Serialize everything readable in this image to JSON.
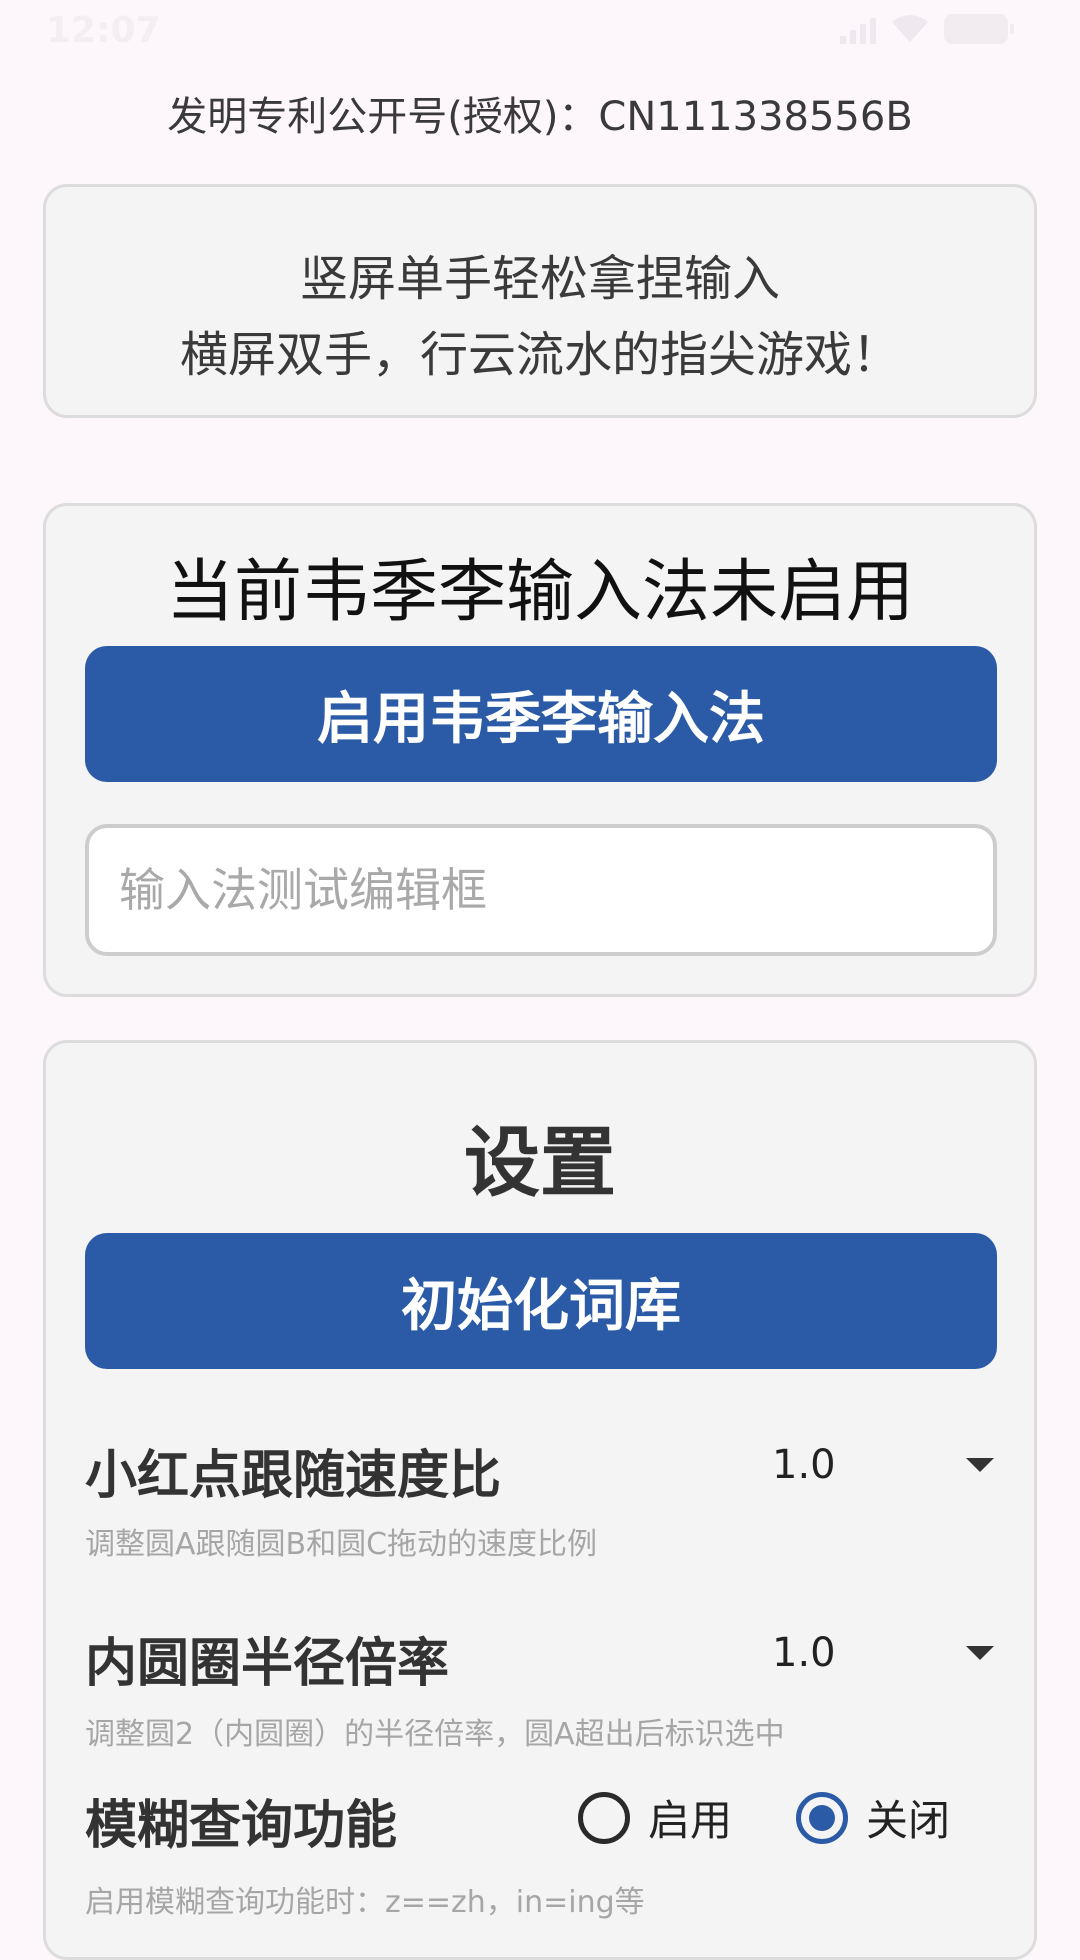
{
  "status_bar": {
    "time": "12:07",
    "icons": [
      "signal-icon",
      "wifi-icon",
      "battery-icon"
    ]
  },
  "patent": {
    "text": "发明专利公开号(授权)：CN111338556B"
  },
  "slogan": {
    "line1": "竖屏单手轻松拿捏输入",
    "line2": "横屏双手，行云流水的指尖游戏！"
  },
  "ime_status": {
    "title": "当前韦季李输入法未启用",
    "enable_button": "启用韦季李输入法",
    "test_input_placeholder": "输入法测试编辑框",
    "test_input_value": ""
  },
  "settings": {
    "title": "设置",
    "init_button": "初始化词库",
    "follow_speed": {
      "label": "小红点跟随速度比",
      "value": "1.0",
      "description": "调整圆A跟随圆B和圆C拖动的速度比例"
    },
    "inner_radius": {
      "label": "内圆圈半径倍率",
      "value": "1.0",
      "description": "调整圆2（内圆圈）的半径倍率，圆A超出后标识选中"
    },
    "fuzzy_query": {
      "label": "模糊查询功能",
      "option_on": "启用",
      "option_off": "关闭",
      "selected": "关闭",
      "description": "启用模糊查询功能时：z==zh，in=ing等"
    }
  },
  "colors": {
    "primary": "#2B5BA7",
    "background": "#FDF7FC",
    "card": "#F4F4F4"
  }
}
